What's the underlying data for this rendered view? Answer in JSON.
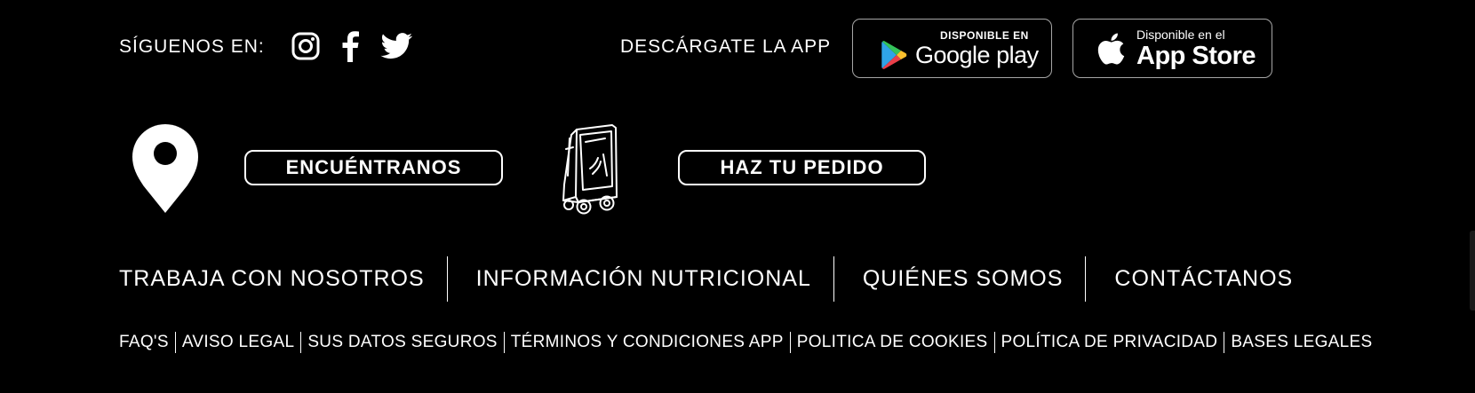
{
  "social": {
    "label": "SÍGUENOS EN:",
    "icons": [
      "instagram-icon",
      "facebook-icon",
      "twitter-icon"
    ]
  },
  "app_download": {
    "label": "DESCÁRGATE LA APP",
    "google_play": {
      "small_text": "DISPONIBLE EN",
      "big_text": "Google play"
    },
    "app_store": {
      "small_text": "Disponible en el",
      "big_text": "App Store"
    }
  },
  "actions": {
    "find_label": "ENCUÉNTRANOS",
    "order_label": "HAZ TU PEDIDO",
    "find_icon": "map-pin-icon",
    "order_icon": "delivery-cart-icon"
  },
  "main_links": [
    "TRABAJA CON NOSOTROS",
    "INFORMACIÓN NUTRICIONAL",
    "QUIÉNES SOMOS",
    "CONTÁCTANOS"
  ],
  "legal_links": [
    "FAQ'S",
    "AVISO LEGAL",
    "SUS DATOS SEGUROS",
    "TÉRMINOS Y CONDICIONES APP",
    "POLITICA DE COOKIES",
    "POLÍTICA DE PRIVACIDAD",
    "BASES LEGALES"
  ],
  "colors": {
    "background": "#000000",
    "text": "#ffffff",
    "badge_border": "#a6a6a6"
  }
}
